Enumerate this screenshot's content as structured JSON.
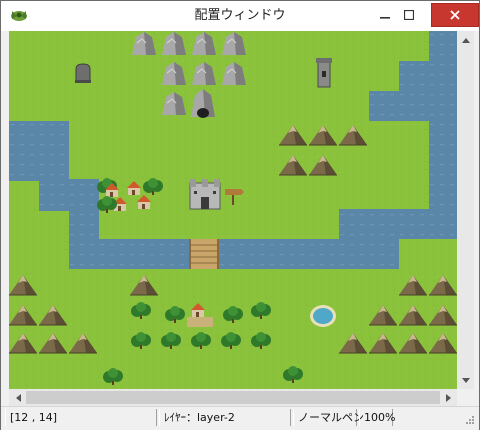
{
  "window": {
    "title": "配置ウィンドウ",
    "icon": "app-icon",
    "controls": [
      "minimize-icon",
      "maximize-icon",
      "close-icon"
    ],
    "close_color": "#c7372f"
  },
  "status": {
    "coords": "[12 , 14]",
    "layer": "ﾚｲﾔｰ：layer-2",
    "pen": "ノーマルペン",
    "zoom": "100%"
  },
  "colors": {
    "grass": "#8bc23c",
    "water": "#5a86a8",
    "bridge": "#c9a56a"
  },
  "map_objects": [
    "castle",
    "village",
    "signpost",
    "cave",
    "tower",
    "gravestone",
    "pond",
    "bridge",
    "mountains",
    "forest",
    "river"
  ]
}
